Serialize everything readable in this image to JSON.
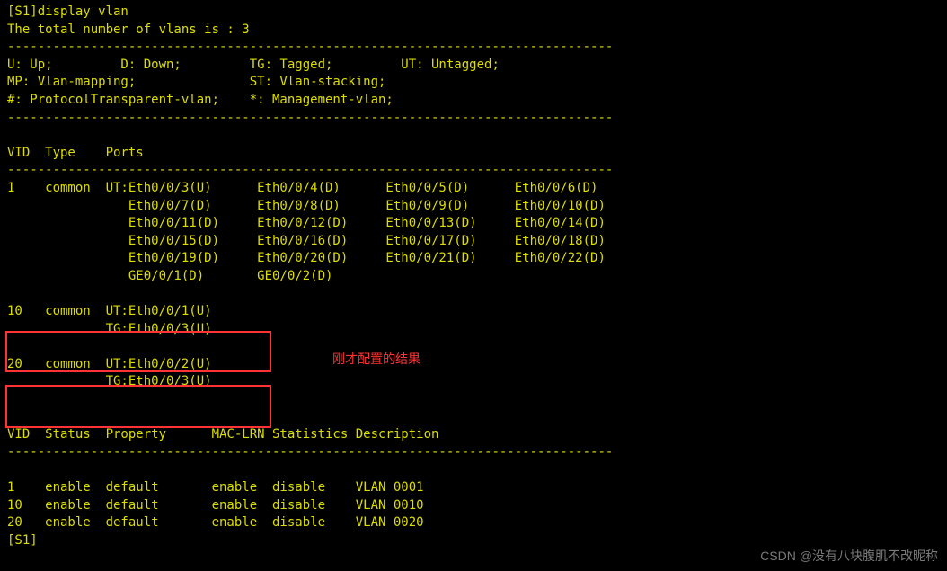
{
  "header": {
    "cmd": "[S1]display vlan",
    "total": "The total number of vlans is : 3",
    "sep": "--------------------------------------------------------------------------------",
    "legend1": "U: Up;         D: Down;         TG: Tagged;         UT: Untagged;",
    "legend2": "MP: Vlan-mapping;               ST: Vlan-stacking;",
    "legend3": "#: ProtocolTransparent-vlan;    *: Management-vlan;",
    "sep2": "--------------------------------------------------------------------------------"
  },
  "ports_header": "VID  Type    Ports",
  "sep3": "--------------------------------------------------------------------------------",
  "vlan1": {
    "r1": "1    common  UT:Eth0/0/3(U)      Eth0/0/4(D)      Eth0/0/5(D)      Eth0/0/6(D)",
    "r2": "                Eth0/0/7(D)      Eth0/0/8(D)      Eth0/0/9(D)      Eth0/0/10(D)",
    "r3": "                Eth0/0/11(D)     Eth0/0/12(D)     Eth0/0/13(D)     Eth0/0/14(D)",
    "r4": "                Eth0/0/15(D)     Eth0/0/16(D)     Eth0/0/17(D)     Eth0/0/18(D)",
    "r5": "                Eth0/0/19(D)     Eth0/0/20(D)     Eth0/0/21(D)     Eth0/0/22(D)",
    "r6": "                GE0/0/1(D)       GE0/0/2(D)"
  },
  "vlan10": {
    "r1": "10   common  UT:Eth0/0/1(U)",
    "r2": "             TG:Eth0/0/3(U)"
  },
  "vlan20": {
    "r1": "20   common  UT:Eth0/0/2(U)",
    "r2": "             TG:Eth0/0/3(U)"
  },
  "status_header": "VID  Status  Property      MAC-LRN Statistics Description",
  "sep4": "--------------------------------------------------------------------------------",
  "status_rows": {
    "r1": "1    enable  default       enable  disable    VLAN 0001",
    "r2": "10   enable  default       enable  disable    VLAN 0010",
    "r3": "20   enable  default       enable  disable    VLAN 0020"
  },
  "prompt": "[S1]",
  "annotation": "刚才配置的结果",
  "watermark": "CSDN @没有八块腹肌不改昵称"
}
